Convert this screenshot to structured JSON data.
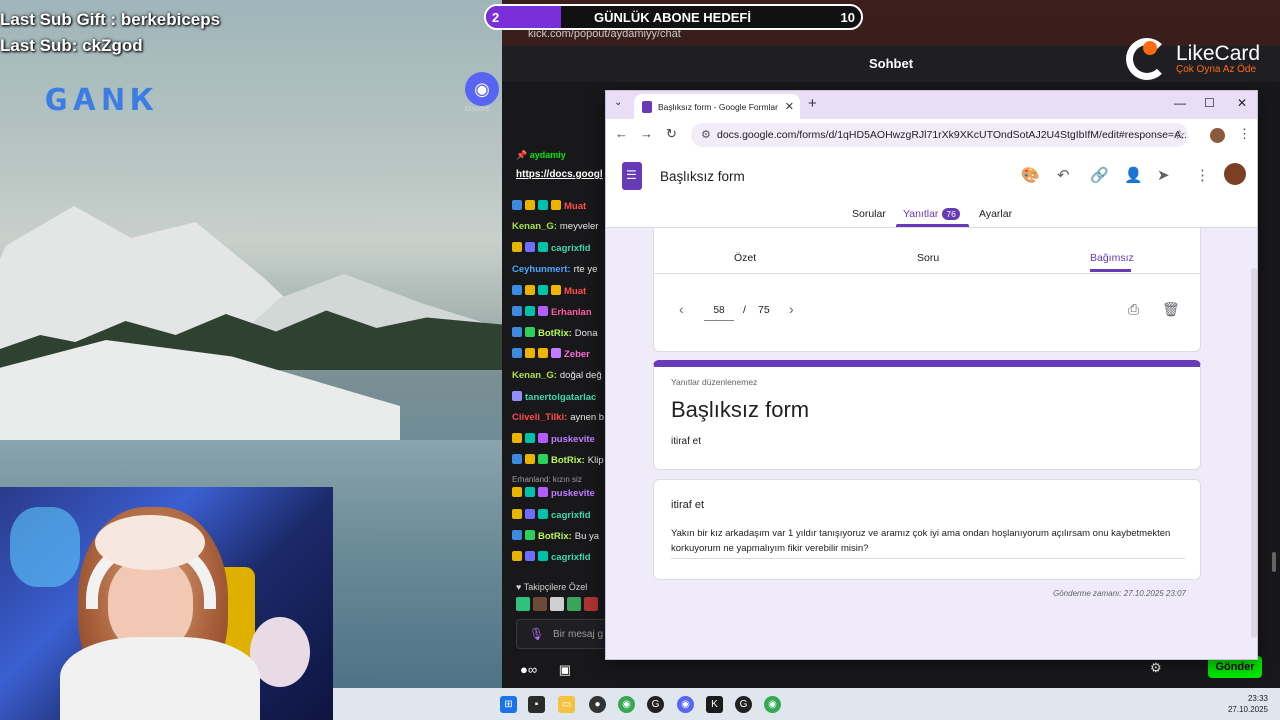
{
  "overlay": {
    "last_sub_gift": "Last Sub Gift : berkebiceps",
    "last_sub": "Last Sub: ckZgod",
    "logo": "GANK"
  },
  "goal": {
    "current": "2",
    "title": "GÜNLÜK ABONE HEDEFİ",
    "target": "10",
    "progress": 0.2
  },
  "likecard": {
    "name": "LikeCard",
    "tagline": "Çok Oyna  Az Öde"
  },
  "discord": {
    "label": "Discord"
  },
  "chat": {
    "url": "kick.com/popout/aydamiyy/chat",
    "header": "Sohbet",
    "pinned_user": "aydamiy",
    "pinned_link": "https://docs.googl",
    "messages": [
      {
        "user": "Muat",
        "text": "",
        "color": "#ff4d4d",
        "badges": [
          "#3d8be0",
          "#e8b400",
          "#00c2a8",
          "#f0b400"
        ]
      },
      {
        "user": "Kenan_G:",
        "text": "meyveler",
        "color": "#a7e34a",
        "badges": []
      },
      {
        "user": "cagrixfid",
        "text": "",
        "color": "#3fd8a9",
        "badges": [
          "#e8b400",
          "#6d6dff",
          "#00c2a8"
        ]
      },
      {
        "user": "Ceyhunmert:",
        "text": "rte ye",
        "color": "#4fa8ff",
        "badges": []
      },
      {
        "user": "Muat",
        "text": "",
        "color": "#ff4d4d",
        "badges": [
          "#3d8be0",
          "#e8b400",
          "#00c2a8",
          "#f0b400"
        ]
      },
      {
        "user": "Erhanlan",
        "text": "",
        "color": "#ff5aa0",
        "badges": [
          "#3d8be0",
          "#00c2a8",
          "#b45cff"
        ]
      },
      {
        "user": "BotRix:",
        "text": "Dona",
        "color": "#b7f75a",
        "badges": [
          "#3d8be0",
          "#2bd15a"
        ]
      },
      {
        "user": "Zeber",
        "text": "",
        "color": "#ff6ad5",
        "badges": [
          "#3d8be0",
          "#e8b400",
          "#f0b400",
          "#c47bff"
        ]
      },
      {
        "user": "Kenan_G:",
        "text": "doğal değ",
        "color": "#a7e34a",
        "badges": []
      },
      {
        "user": "tanertolgatarlac",
        "text": "",
        "color": "#3fd8a9",
        "badges": [
          "#8f8fff"
        ]
      },
      {
        "user": "Ciiveli_Tilki:",
        "text": "aynen b",
        "color": "#ff4d4d",
        "badges": []
      },
      {
        "user": "puskevite",
        "text": "",
        "color": "#c47bff",
        "badges": [
          "#e8b400",
          "#00c2a8",
          "#b45cff"
        ]
      },
      {
        "user": "BotRix:",
        "text": "Klip a",
        "color": "#b7f75a",
        "badges": [
          "#3d8be0",
          "#e8b400",
          "#2bd15a"
        ]
      },
      {
        "user": "puskevite",
        "text": "",
        "color": "#c47bff",
        "badges": [
          "#e8b400",
          "#00c2a8",
          "#b45cff"
        ]
      },
      {
        "user": "cagrixfid",
        "text": "",
        "color": "#3fd8a9",
        "badges": [
          "#e8b400",
          "#6d6dff",
          "#00c2a8"
        ]
      },
      {
        "user": "BotRix:",
        "text": "Bu ya",
        "color": "#b7f75a",
        "badges": [
          "#3d8be0",
          "#2bd15a"
        ]
      },
      {
        "user": "cagrixfid",
        "text": "",
        "color": "#3fd8a9",
        "badges": [
          "#e8b400",
          "#6d6dff",
          "#00c2a8"
        ]
      }
    ],
    "reply_hint": "Erhanland: kızın siz",
    "follow_label": "Takipçilere Özel",
    "input_placeholder": "Bir mesaj g",
    "send_label": "Gönder"
  },
  "browser": {
    "tab_title": "Başlıksız form - Google Formlar",
    "url": "docs.google.com/forms/d/1qHD5AOHwzgRJl71rXk9XKcUTOndSotAJ2U4StgIbIfM/edit#response=A...",
    "form_title": "Başlıksız form",
    "tabs": [
      {
        "label": "Sorular"
      },
      {
        "label": "Yanıtlar",
        "count": "76"
      },
      {
        "label": "Ayarlar"
      }
    ],
    "subtabs": [
      "Özet",
      "Soru",
      "Bağımsız"
    ],
    "pager": {
      "current": "58",
      "separator": "/",
      "total": "75"
    },
    "card": {
      "note": "Yanıtlar düzenlenemez",
      "title": "Başlıksız form",
      "description": "itiraf et"
    },
    "question": {
      "title": "itiraf et",
      "answer": "Yakın bir kız arkadaşım var 1 yıldır tanışıyoruz ve aramız çok iyi ama ondan hoşlanıyorum açılırsam onu kaybetmekten korkuyorum ne yapmalıyım fikir verebilir misin?"
    },
    "submitted": "Gönderme zamanı: 27.10.2025 23:07"
  },
  "taskbar": {
    "time": "23:33",
    "date": "27.10.2025"
  }
}
